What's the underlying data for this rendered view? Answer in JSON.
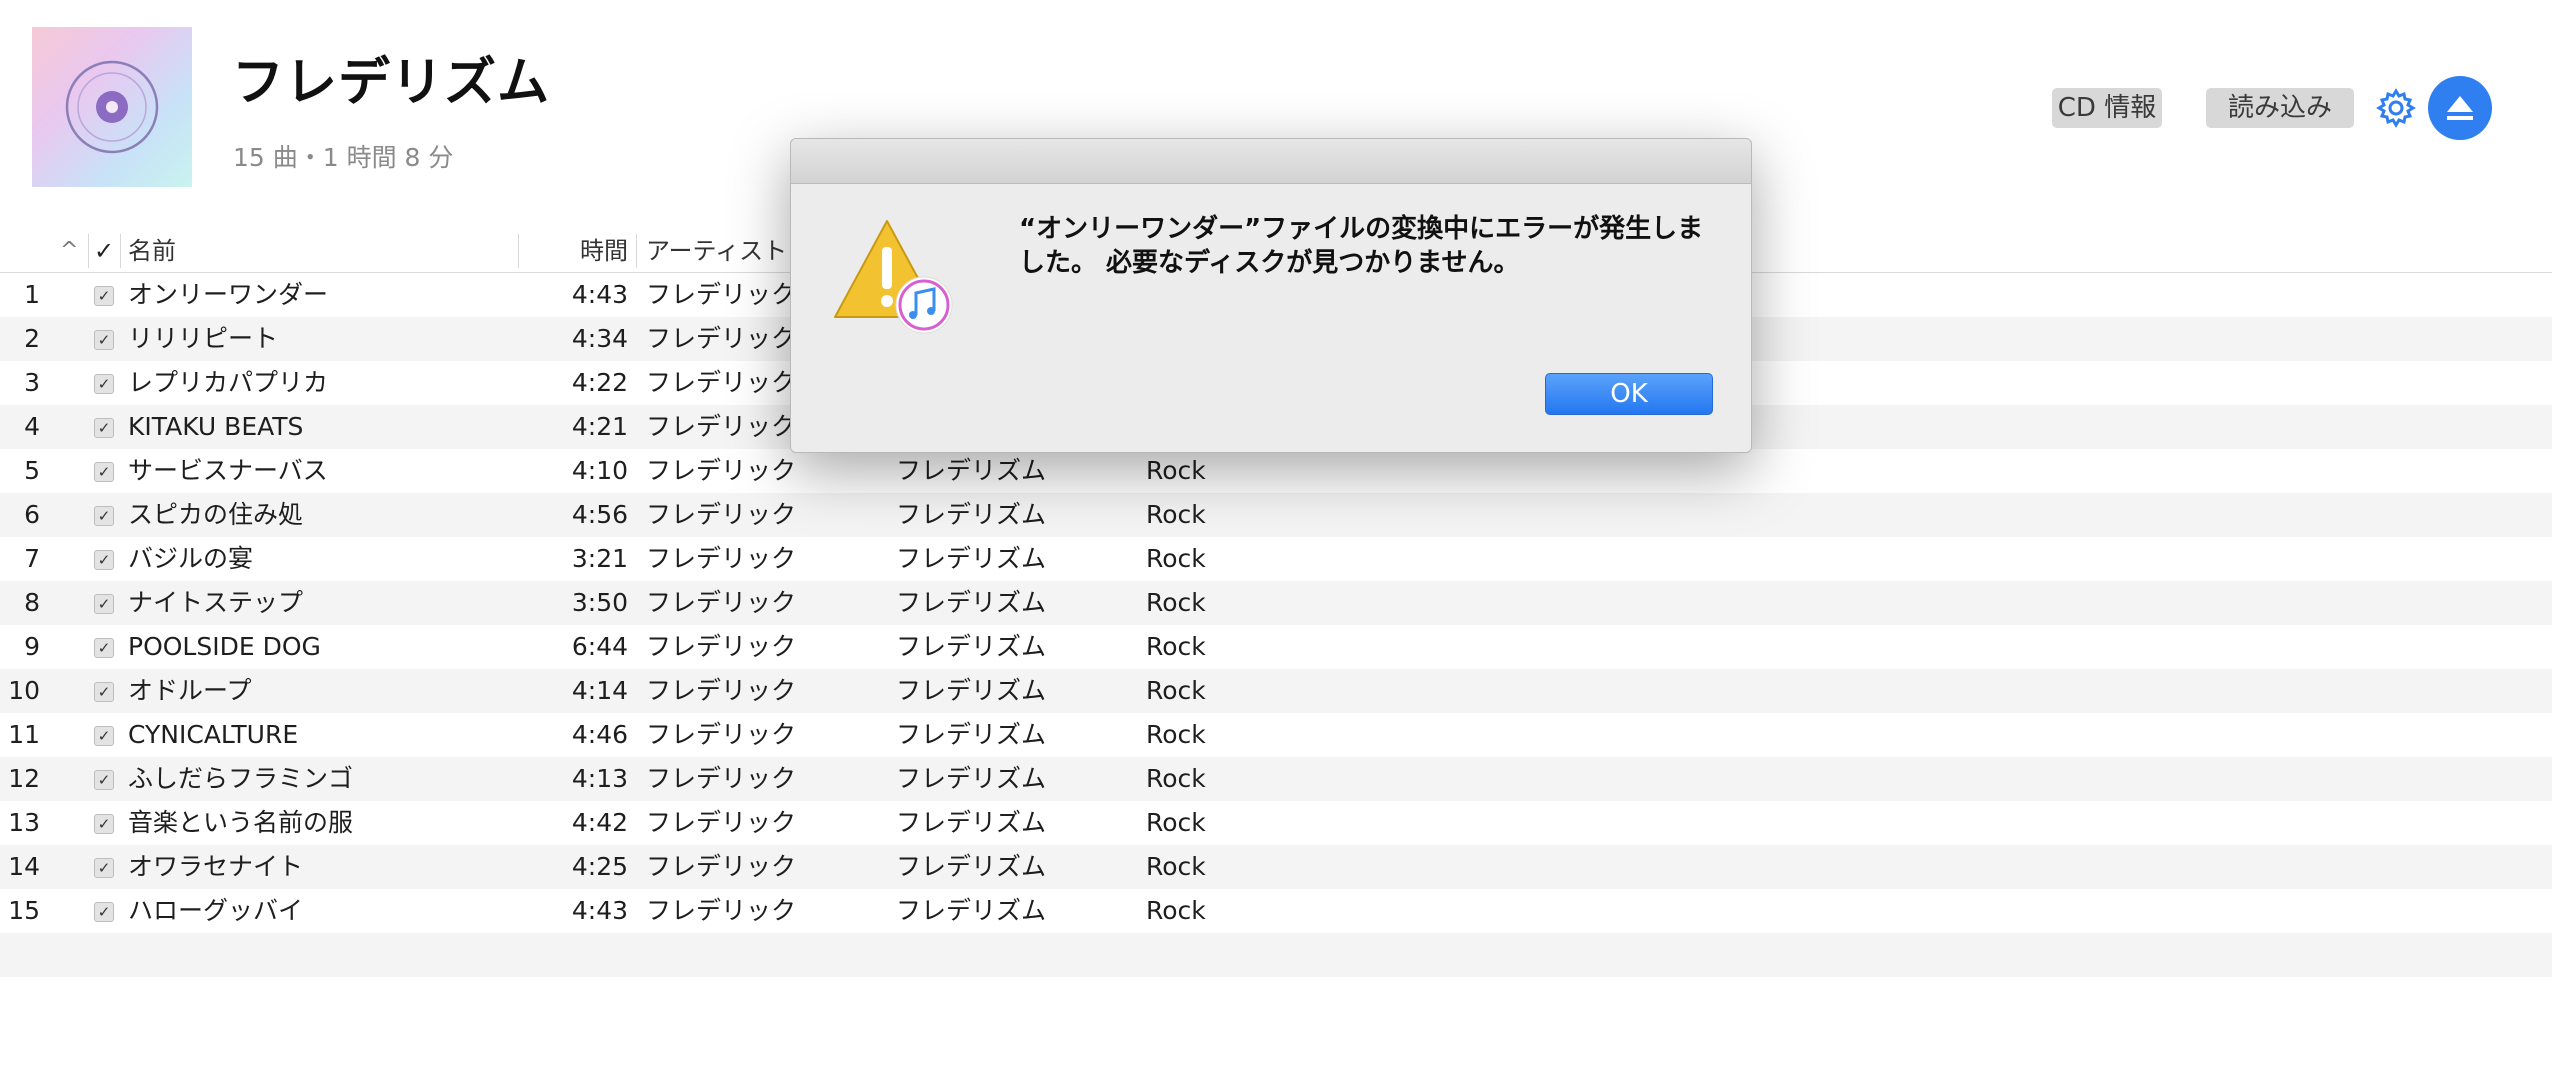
{
  "album": {
    "title": "フレデリズム",
    "subtitle": "15 曲・1 時間 8 分"
  },
  "header_buttons": {
    "cd_info": "CD 情報",
    "import": "読み込み",
    "settings_icon": "gear-icon",
    "eject_icon": "eject-icon",
    "accent_color": "#2f7ff0"
  },
  "table": {
    "columns": {
      "sort": "^",
      "check": "✓",
      "name": "名前",
      "time": "時間",
      "artist": "アーティスト"
    },
    "rows": [
      {
        "num": "1",
        "name": "オンリーワンダー",
        "time": "4:43",
        "artist": "フレデリック",
        "album": "",
        "genre": ""
      },
      {
        "num": "2",
        "name": "リリリピート",
        "time": "4:34",
        "artist": "フレデリック",
        "album": "",
        "genre": ""
      },
      {
        "num": "3",
        "name": "レプリカパプリカ",
        "time": "4:22",
        "artist": "フレデリック",
        "album": "",
        "genre": ""
      },
      {
        "num": "4",
        "name": "KITAKU BEATS",
        "time": "4:21",
        "artist": "フレデリック",
        "album": "",
        "genre": ""
      },
      {
        "num": "5",
        "name": "サービスナーバス",
        "time": "4:10",
        "artist": "フレデリック",
        "album": "フレデリズム",
        "genre": "Rock"
      },
      {
        "num": "6",
        "name": "スピカの住み処",
        "time": "4:56",
        "artist": "フレデリック",
        "album": "フレデリズム",
        "genre": "Rock"
      },
      {
        "num": "7",
        "name": "バジルの宴",
        "time": "3:21",
        "artist": "フレデリック",
        "album": "フレデリズム",
        "genre": "Rock"
      },
      {
        "num": "8",
        "name": "ナイトステップ",
        "time": "3:50",
        "artist": "フレデリック",
        "album": "フレデリズム",
        "genre": "Rock"
      },
      {
        "num": "9",
        "name": "POOLSIDE DOG",
        "time": "6:44",
        "artist": "フレデリック",
        "album": "フレデリズム",
        "genre": "Rock"
      },
      {
        "num": "10",
        "name": "オドループ",
        "time": "4:14",
        "artist": "フレデリック",
        "album": "フレデリズム",
        "genre": "Rock"
      },
      {
        "num": "11",
        "name": "CYNICALTURE",
        "time": "4:46",
        "artist": "フレデリック",
        "album": "フレデリズム",
        "genre": "Rock"
      },
      {
        "num": "12",
        "name": "ふしだらフラミンゴ",
        "time": "4:13",
        "artist": "フレデリック",
        "album": "フレデリズム",
        "genre": "Rock"
      },
      {
        "num": "13",
        "name": "音楽という名前の服",
        "time": "4:42",
        "artist": "フレデリック",
        "album": "フレデリズム",
        "genre": "Rock"
      },
      {
        "num": "14",
        "name": "オワラセナイト",
        "time": "4:25",
        "artist": "フレデリック",
        "album": "フレデリズム",
        "genre": "Rock"
      },
      {
        "num": "15",
        "name": "ハローグッバイ",
        "time": "4:43",
        "artist": "フレデリック",
        "album": "フレデリズム",
        "genre": "Rock"
      }
    ]
  },
  "dialog": {
    "message_line1": "“オンリーワンダー”ファイルの変換中にエラーが発生しま",
    "message_line2": "した。 必要なディスクが見つかりません。",
    "ok_label": "OK",
    "icon": "warning-itunes-icon"
  }
}
